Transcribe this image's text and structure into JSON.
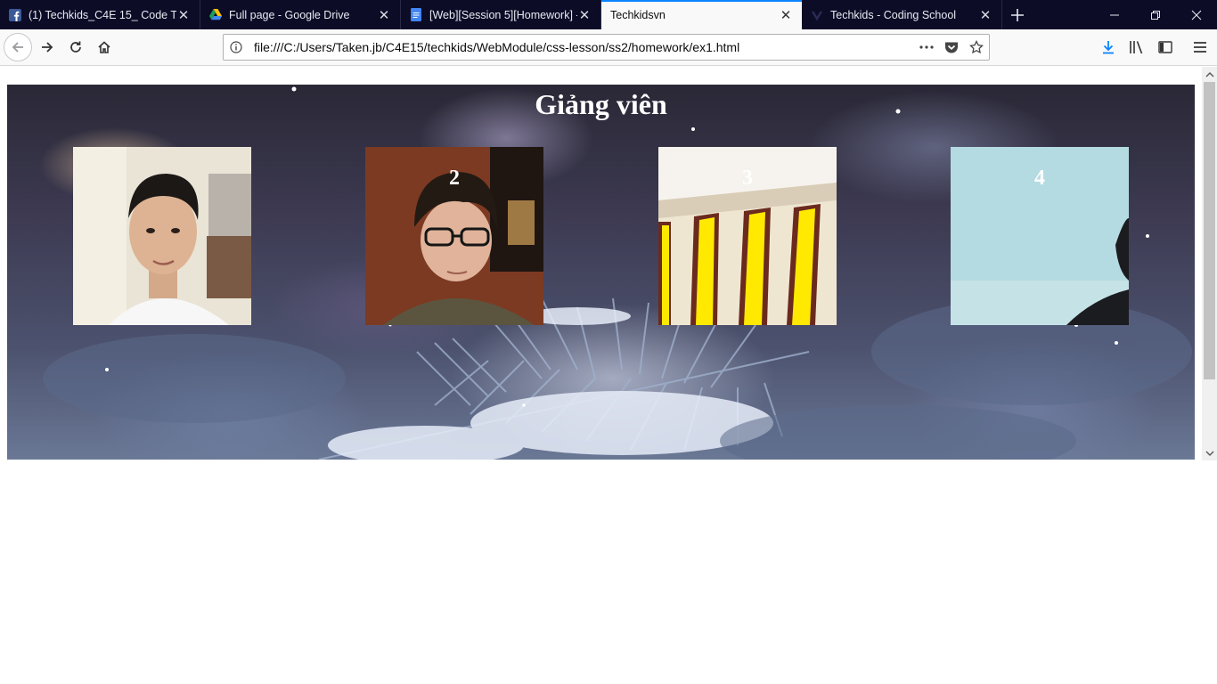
{
  "browser": {
    "tabs": [
      {
        "title": "(1) Techkids_C4E 15_ Code The",
        "icon": "facebook-icon",
        "active": false
      },
      {
        "title": "Full page - Google Drive",
        "icon": "google-drive-icon",
        "active": false
      },
      {
        "title": "[Web][Session 5][Homework] -",
        "icon": "google-docs-icon",
        "active": false
      },
      {
        "title": "Techkidsvn",
        "icon": "",
        "active": true
      },
      {
        "title": "Techkids - Coding School",
        "icon": "techkids-icon",
        "active": false
      }
    ],
    "address": "file:///C:/Users/Taken.jb/C4E15/techkids/WebModule/css-lesson/ss2/homework/ex1.html",
    "colors": {
      "tabstrip": "#0c0c27",
      "accent": "#0a84ff"
    }
  },
  "page": {
    "title": "Giảng viên",
    "cards": [
      {
        "number": "",
        "image": "portrait-man-white-shirt"
      },
      {
        "number": "2",
        "image": "portrait-man-glasses"
      },
      {
        "number": "3",
        "image": "yellow-stripes-photo"
      },
      {
        "number": "4",
        "image": "pale-blue-wall-photo"
      }
    ]
  }
}
